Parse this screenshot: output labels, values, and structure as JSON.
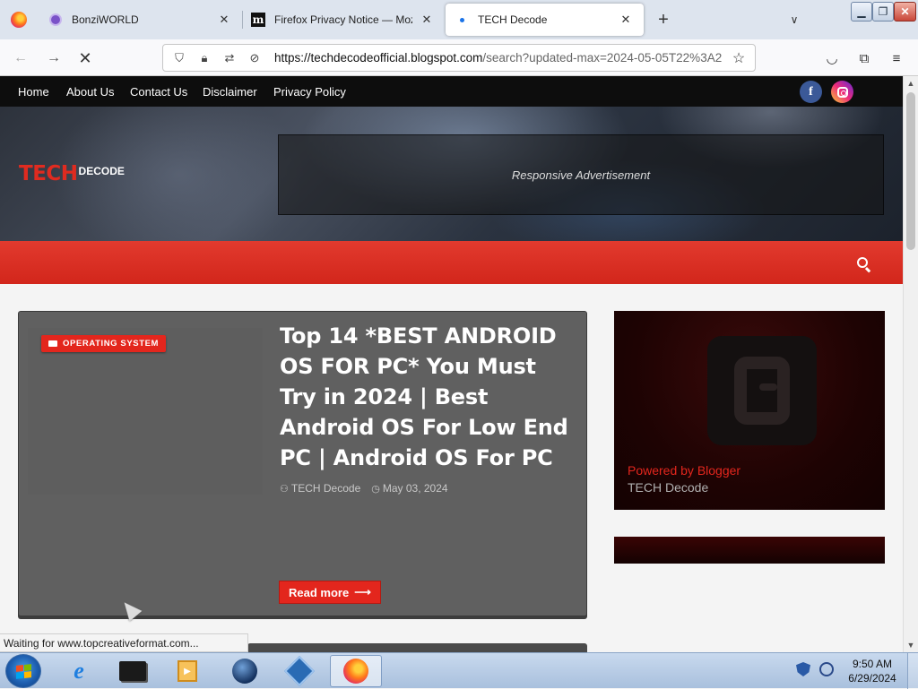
{
  "browser": {
    "tabs": [
      {
        "title": "BonziWORLD",
        "icon": "bonzi-icon"
      },
      {
        "title": "Firefox Privacy Notice — Mozill",
        "icon": "mozilla-m-icon"
      },
      {
        "title": "TECH Decode",
        "icon": "loading-dot-icon",
        "active": true
      }
    ],
    "url_domain": "https://techdecodeofficial.blogspot.com",
    "url_path": "/search?updated-max=2024-05-05T22%3A2",
    "status_text": "Waiting for www.topcreativeformat.com..."
  },
  "site": {
    "nav": [
      "Home",
      "About Us",
      "Contact Us",
      "Disclaimer",
      "Privacy Policy"
    ],
    "logo_tech": "TECH",
    "logo_decode": "DECODE",
    "ad_text": "Responsive Advertisement",
    "accent_color": "#e3261d"
  },
  "post": {
    "category": "OPERATING SYSTEM",
    "title": "Top 14 *BEST ANDROID OS FOR PC* You Must Try in 2024 | Best Android OS For Low End PC | Android OS For PC",
    "author": "TECH Decode",
    "date": "May 03, 2024",
    "read_more": "Read more"
  },
  "sidebar": {
    "powered_by": "Powered by Blogger",
    "blog_name": "TECH Decode"
  },
  "taskbar": {
    "time": "9:50 AM",
    "date": "6/29/2024"
  }
}
